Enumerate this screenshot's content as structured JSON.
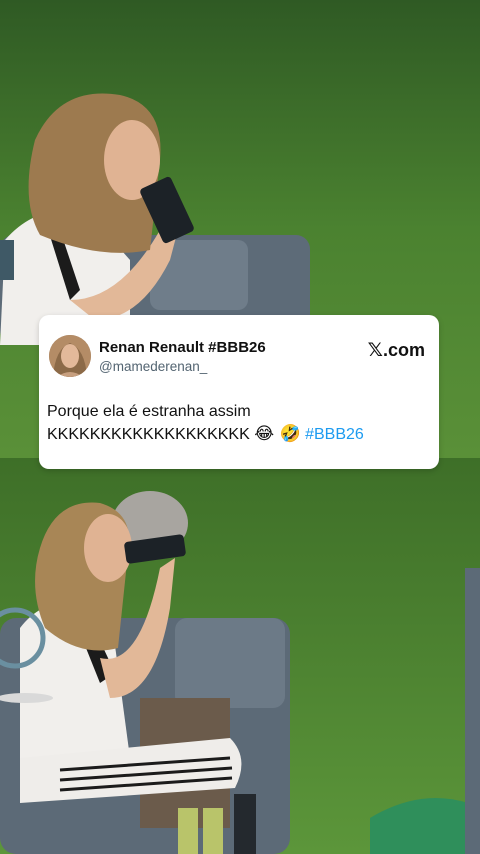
{
  "tweet": {
    "author_name": "Renan Renault #BBB26",
    "author_handle": "@mamederenan_",
    "brand": "com",
    "text_line1": "Porque ela é estranha assim",
    "text_line2_main": "KKKKKKKKKKKKKKKKKKK",
    "emojis": "😂 🤣",
    "hashtag": "#BBB26"
  },
  "icons": {
    "brand": "x-logo-icon",
    "emoji_1": "face-with-tears-of-joy-icon",
    "emoji_2": "rolling-on-the-floor-laughing-icon"
  },
  "colors": {
    "hashtag": "#1d9bf0",
    "handle": "#536471",
    "grass": "#4a7a2e",
    "card": "#ffffff"
  }
}
